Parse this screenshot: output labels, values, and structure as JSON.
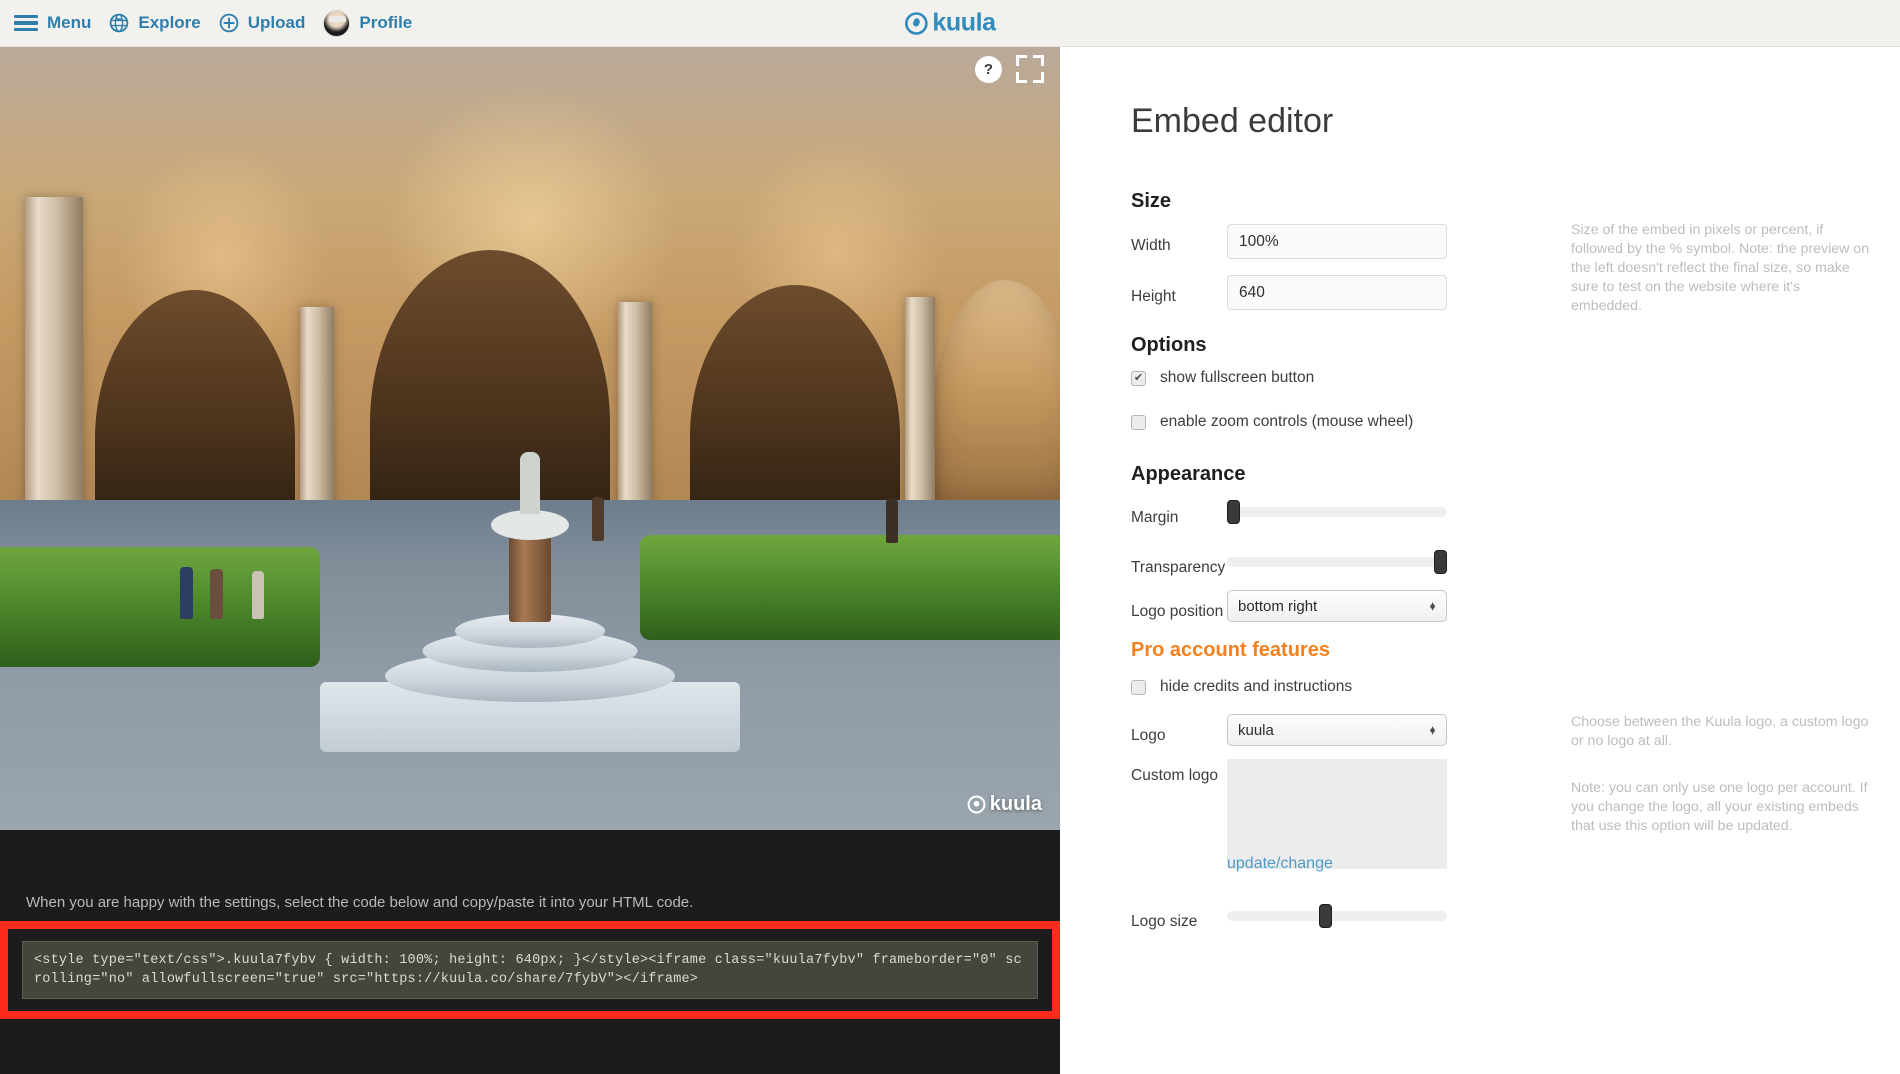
{
  "topbar": {
    "items": [
      {
        "label": "Menu",
        "icon": "hamburger-icon"
      },
      {
        "label": "Explore",
        "icon": "globe-icon"
      },
      {
        "label": "Upload",
        "icon": "plus-circle-icon"
      },
      {
        "label": "Profile",
        "icon": "avatar-icon"
      }
    ],
    "brand": "kuula",
    "brand_color": "#2f8cbd",
    "link_color": "#2f7fad",
    "background": "#f2f1ed"
  },
  "viewer": {
    "help_button": "?",
    "fullscreen_button": "fullscreen-icon",
    "watermark": "kuula",
    "scene_description": "360 panorama of a Renaissance palace courtyard with arcades, frescoed walls, potted hedges and a central fountain"
  },
  "code_panel": {
    "hint": "When you are happy with the settings, select the code below and copy/paste it into your HTML code.",
    "code": "<style type=\"text/css\">.kuula7fybv { width: 100%; height: 640px; }</style><iframe class=\"kuula7fybv\" frameborder=\"0\" scrolling=\"no\" allowfullscreen=\"true\" src=\"https://kuula.co/share/7fybV\"></iframe>",
    "highlight_color": "#fc2b1e"
  },
  "editor": {
    "title": "Embed editor",
    "sections": {
      "size": {
        "heading": "Size",
        "width": {
          "label": "Width",
          "value": "100%",
          "placeholder": "width"
        },
        "height": {
          "label": "Height",
          "value": "640",
          "placeholder": "height"
        },
        "help": "Size of the embed in pixels or percent, if followed by the % symbol. Note: the preview on the left doesn't reflect the final size, so make sure to test on the website where it's embedded."
      },
      "options": {
        "heading": "Options",
        "fullscreen": {
          "label": "show fullscreen button",
          "checked": true,
          "mark": "✔"
        },
        "zoom": {
          "label": "enable zoom controls (mouse wheel)",
          "checked": false,
          "mark": ""
        }
      },
      "appearance": {
        "heading": "Appearance",
        "margin": {
          "label": "Margin",
          "value": 0
        },
        "transparency": {
          "label": "Transparency",
          "value": 100
        },
        "logo_position": {
          "label": "Logo position",
          "value": "bottom right"
        }
      },
      "pro": {
        "heading": "Pro account features",
        "heading_color": "#f4811f",
        "hide_credits": {
          "label": "hide credits and instructions",
          "checked": false,
          "mark": ""
        },
        "logo": {
          "label": "Logo",
          "value": "kuula"
        },
        "logo_help": "Choose between the Kuula logo, a custom logo or no logo at all.",
        "custom_logo": {
          "label": "Custom logo",
          "action": "update/change"
        },
        "custom_logo_help": "Note: you can only use one logo per account. If you change the logo, all your existing embeds that use this option will be updated.",
        "logo_size": {
          "label": "Logo size",
          "value": 48
        }
      }
    }
  }
}
